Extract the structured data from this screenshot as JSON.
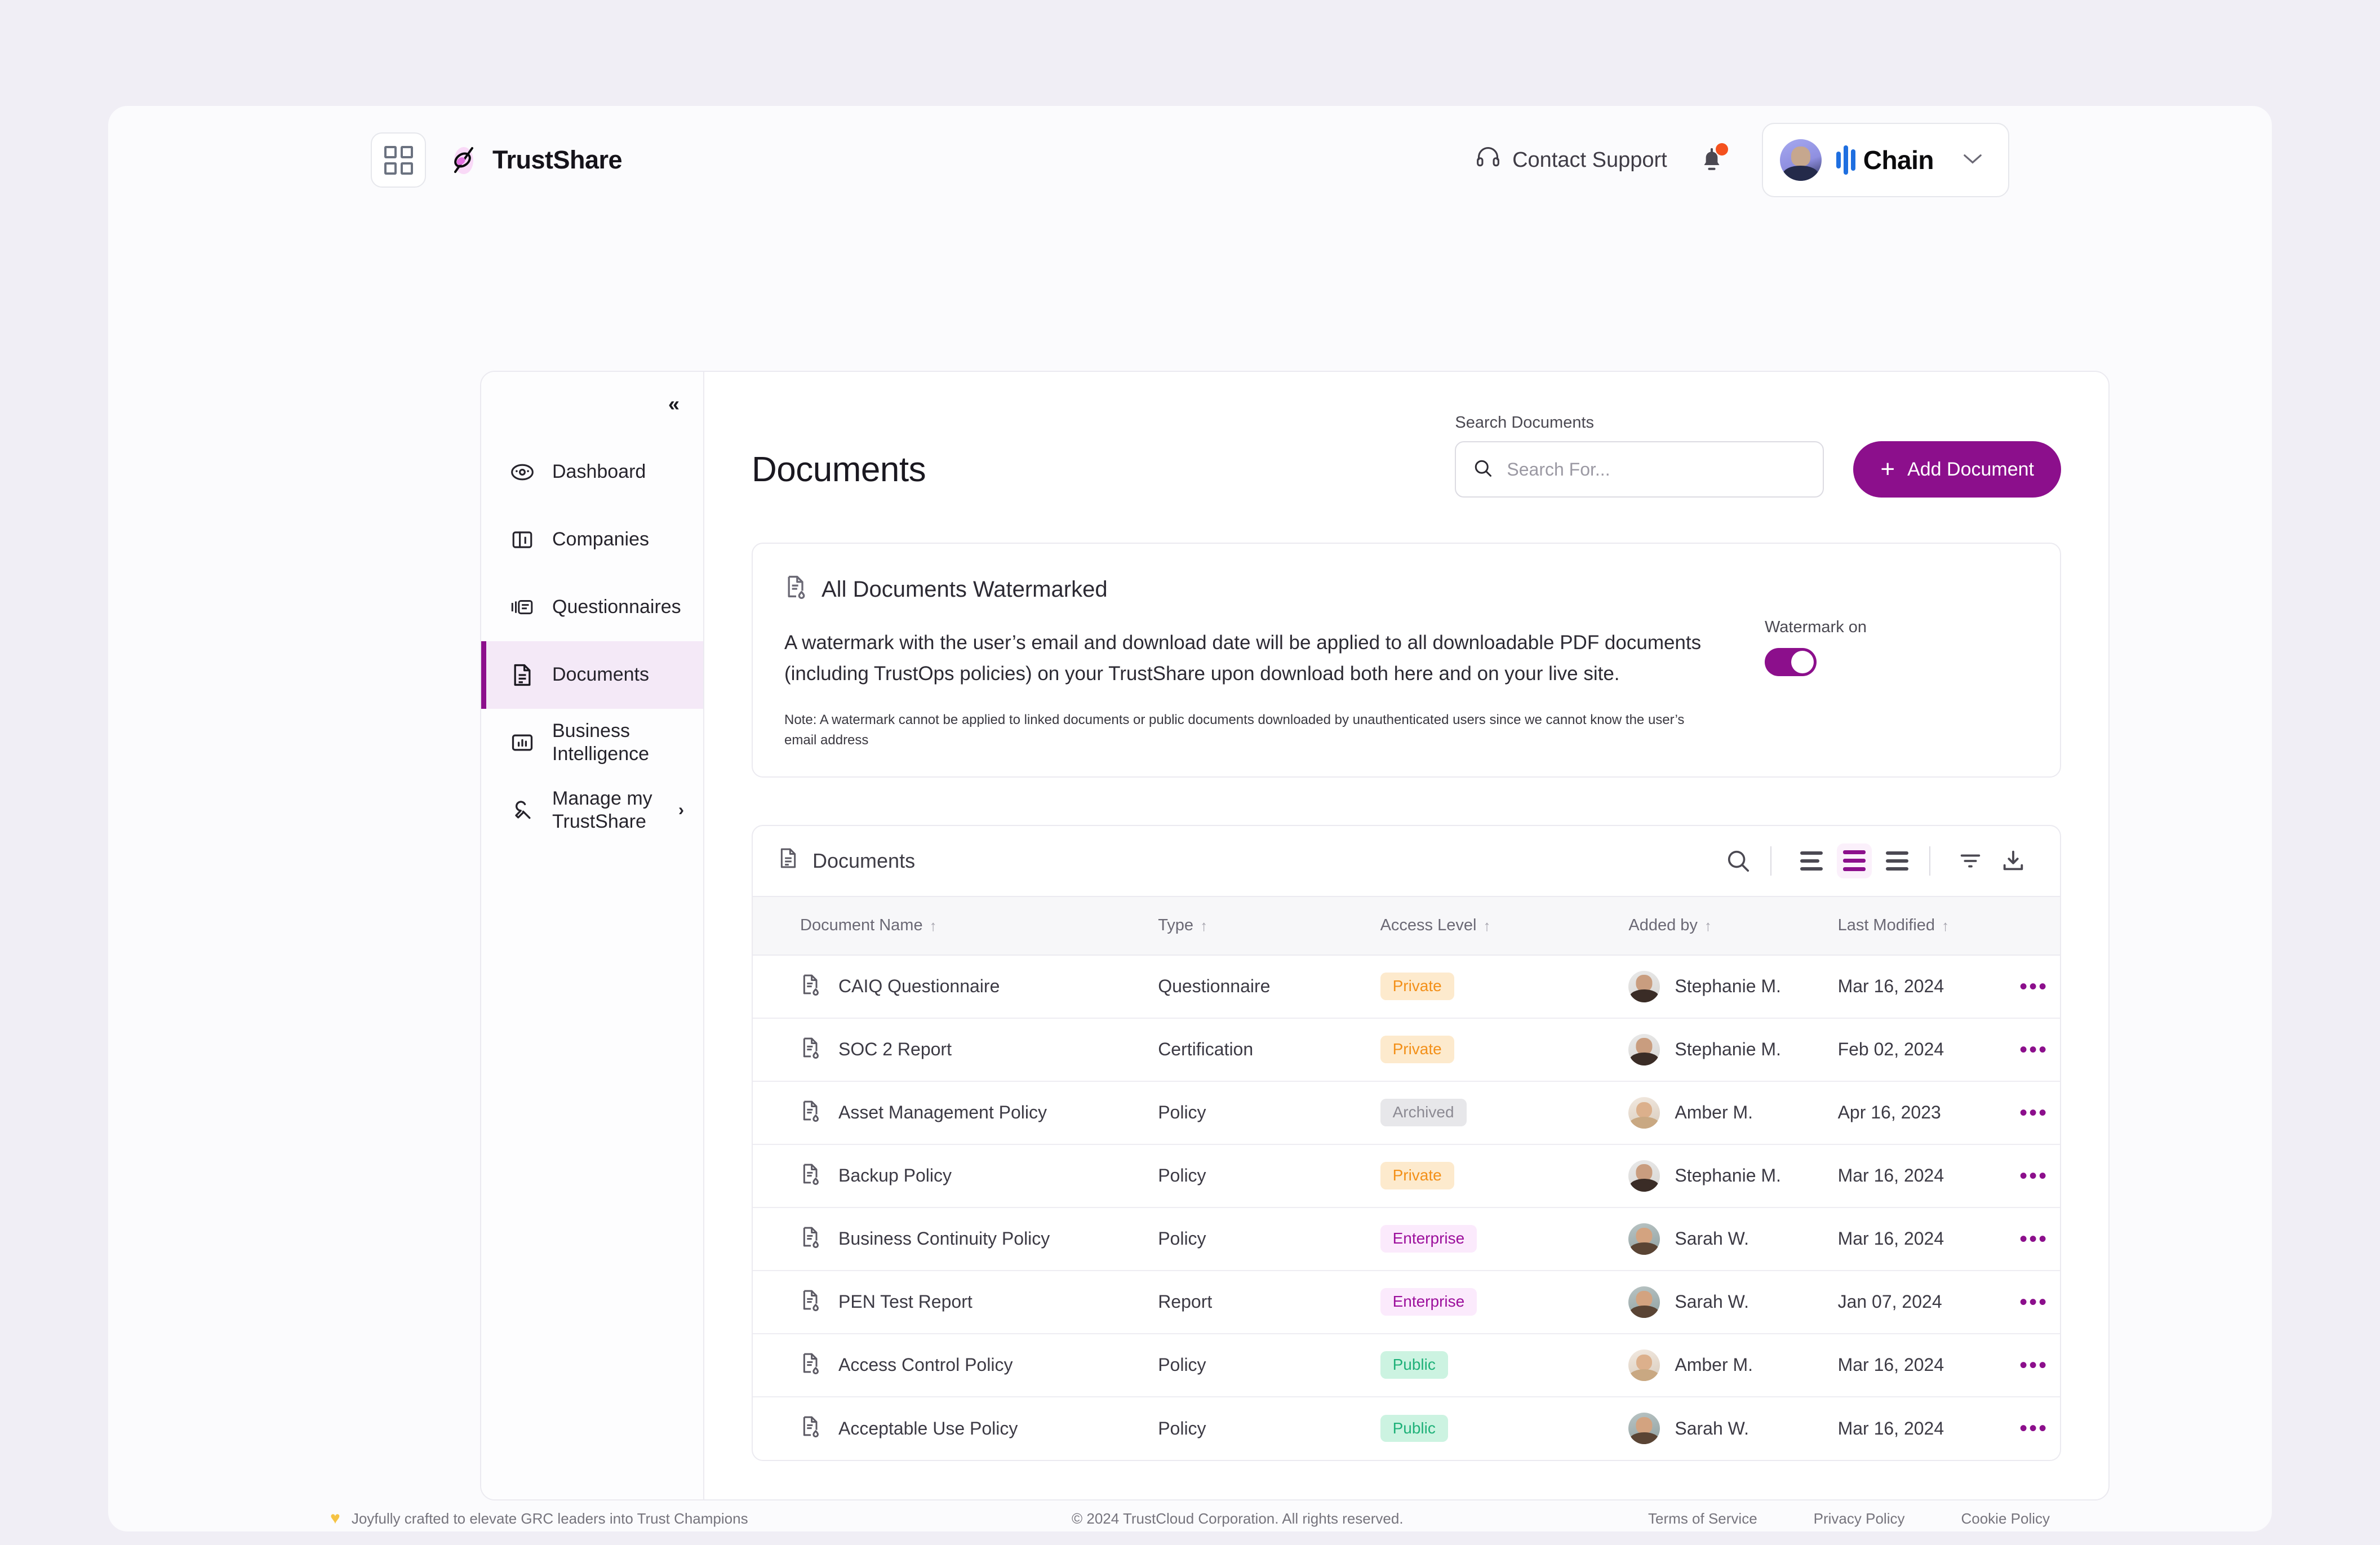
{
  "header": {
    "grid_icon": "grid-apps-icon",
    "brand": "TrustShare",
    "contact_support": "Contact Support",
    "support_icon": "headset-icon",
    "notifications_icon": "bell-icon",
    "account_name": "Chain",
    "account_caret": "chevron-down-icon"
  },
  "sidebar": {
    "collapse_label": "«",
    "items": [
      {
        "label": "Dashboard",
        "icon": "dashboard-icon",
        "active": false,
        "chevron": ""
      },
      {
        "label": "Companies",
        "icon": "companies-icon",
        "active": false,
        "chevron": ""
      },
      {
        "label": "Questionnaires",
        "icon": "questionnaire-icon",
        "active": false,
        "chevron": ""
      },
      {
        "label": "Documents",
        "icon": "document-icon",
        "active": true,
        "chevron": ""
      },
      {
        "label": "Business Intelligence",
        "icon": "bar-chart-icon",
        "active": false,
        "chevron": ""
      },
      {
        "label": "Manage my TrustShare",
        "icon": "wrench-icon",
        "active": false,
        "chevron": "›"
      }
    ]
  },
  "main": {
    "page_title": "Documents",
    "search": {
      "label": "Search Documents",
      "placeholder": "Search For...",
      "value": "",
      "icon": "search-icon"
    },
    "add_button": {
      "label": "Add Document",
      "icon": "plus-icon"
    },
    "watermark_panel": {
      "icon": "document-watermark-icon",
      "title": "All Documents Watermarked",
      "body": "A watermark with the user’s email and download date will be applied to all downloadable PDF documents (including TrustOps policies) on your TrustShare upon download both here and on your live site.",
      "note": "Note: A watermark cannot be applied to linked documents or public documents downloaded by unauthenticated users since we cannot know the user’s email address",
      "toggle_label": "Watermark on",
      "toggle_on": true
    },
    "table": {
      "title": "Documents",
      "title_icon": "document-icon",
      "tools": [
        {
          "name": "search-icon",
          "active": false
        },
        {
          "name": "density-comfortable-icon",
          "active": false
        },
        {
          "name": "density-default-icon",
          "active": true
        },
        {
          "name": "density-compact-icon",
          "active": false
        },
        {
          "name": "filter-icon",
          "active": false
        },
        {
          "name": "download-icon",
          "active": false
        }
      ],
      "columns": [
        "Document Name",
        "Type",
        "Access Level",
        "Added by",
        "Last Modified"
      ],
      "sort_caret": "↑",
      "row_menu_icon": "kebab-menu-icon",
      "rows": [
        {
          "name": "CAIQ Questionnaire",
          "type": "Questionnaire",
          "access": "Private",
          "access_style": "private",
          "added_by": "Stephanie M.",
          "avatar": "av-steph",
          "modified": "Mar 16, 2024"
        },
        {
          "name": "SOC 2 Report",
          "type": "Certification",
          "access": "Private",
          "access_style": "private",
          "added_by": "Stephanie M.",
          "avatar": "av-steph",
          "modified": "Feb 02, 2024"
        },
        {
          "name": "Asset Management Policy",
          "type": "Policy",
          "access": "Archived",
          "access_style": "archived",
          "added_by": "Amber M.",
          "avatar": "av-amber",
          "modified": "Apr 16, 2023"
        },
        {
          "name": "Backup Policy",
          "type": "Policy",
          "access": "Private",
          "access_style": "private",
          "added_by": "Stephanie M.",
          "avatar": "av-steph",
          "modified": "Mar 16, 2024"
        },
        {
          "name": "Business Continuity Policy",
          "type": "Policy",
          "access": "Enterprise",
          "access_style": "enterprise",
          "added_by": "Sarah W.",
          "avatar": "av-sarah",
          "modified": "Mar 16, 2024"
        },
        {
          "name": "PEN Test Report",
          "type": "Report",
          "access": "Enterprise",
          "access_style": "enterprise",
          "added_by": "Sarah W.",
          "avatar": "av-sarah",
          "modified": "Jan 07, 2024"
        },
        {
          "name": "Access Control Policy",
          "type": "Policy",
          "access": "Public",
          "access_style": "public",
          "added_by": "Amber M.",
          "avatar": "av-amber",
          "modified": "Mar 16, 2024"
        },
        {
          "name": "Acceptable Use Policy",
          "type": "Policy",
          "access": "Public",
          "access_style": "public",
          "added_by": "Sarah W.",
          "avatar": "av-sarah",
          "modified": "Mar 16, 2024"
        }
      ]
    }
  },
  "footer": {
    "tagline_icon": "yellow-heart-icon",
    "tagline": "Joyfully crafted to elevate GRC leaders into Trust Champions",
    "copyright": "© 2024 TrustCloud Corporation. All rights reserved.",
    "links": [
      "Terms of Service",
      "Privacy Policy",
      "Cookie Policy"
    ]
  },
  "colors": {
    "accent": "#8c0f8c",
    "private": "#f39019",
    "enterprise": "#9c0f9c",
    "public": "#1fb179",
    "archived": "#8c8a93"
  }
}
